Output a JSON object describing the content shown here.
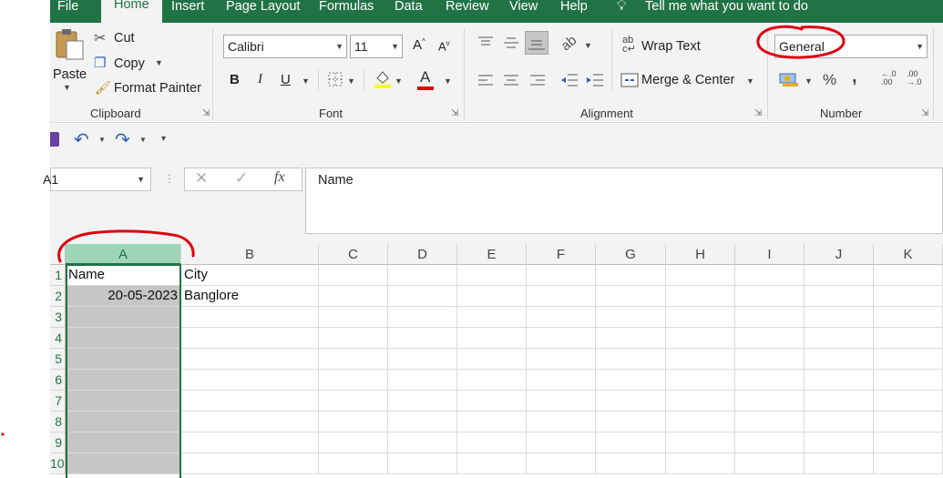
{
  "tabs": [
    {
      "label": "File"
    },
    {
      "label": "Home",
      "active": true
    },
    {
      "label": "Insert"
    },
    {
      "label": "Page Layout"
    },
    {
      "label": "Formulas"
    },
    {
      "label": "Data"
    },
    {
      "label": "Review"
    },
    {
      "label": "View"
    },
    {
      "label": "Help"
    }
  ],
  "tell_me": "Tell me what you want to do",
  "clipboard": {
    "paste": "Paste",
    "cut": "Cut",
    "copy": "Copy",
    "format_painter": "Format Painter",
    "group_label": "Clipboard"
  },
  "font": {
    "name": "Calibri",
    "size": "11",
    "bold": "B",
    "italic": "I",
    "underline": "U",
    "font_color_letter": "A",
    "grow_letter": "A",
    "shrink_letter": "A",
    "group_label": "Font"
  },
  "alignment": {
    "wrap_text": "Wrap Text",
    "merge_center": "Merge & Center",
    "group_label": "Alignment"
  },
  "number": {
    "format": "General",
    "percent": "%",
    "comma": ",",
    "group_label": "Number"
  },
  "formula_bar": {
    "name_box": "A1",
    "fx": "fx",
    "content": "Name"
  },
  "grid": {
    "columns": [
      "A",
      "B",
      "C",
      "D",
      "E",
      "F",
      "G",
      "H",
      "I",
      "J",
      "K"
    ],
    "rows": [
      "1",
      "2",
      "3",
      "4",
      "5",
      "6",
      "7",
      "8",
      "9",
      "10"
    ],
    "cells": [
      [
        "Name",
        "City"
      ],
      [
        "20-05-2023",
        "Banglore"
      ]
    ]
  },
  "colors": {
    "excel_green": "#217346",
    "ribbon_bg": "#f3f3f3",
    "annotation_red": "#e0000f",
    "selected_column": "#c6c6c6"
  }
}
